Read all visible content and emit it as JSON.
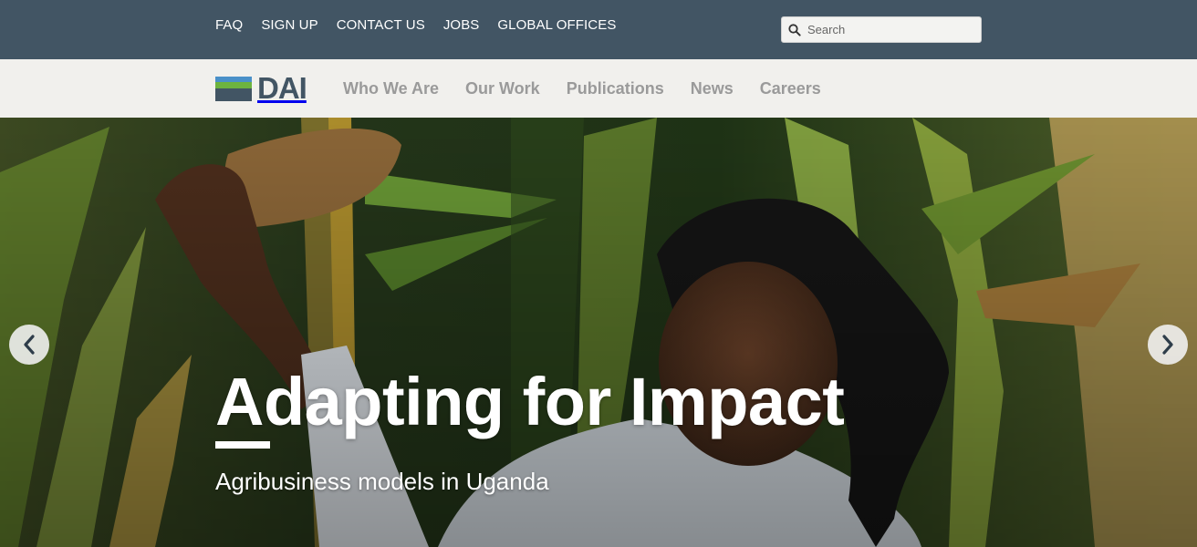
{
  "utility_nav": {
    "links": [
      "FAQ",
      "SIGN UP",
      "CONTACT US",
      "JOBS",
      "GLOBAL OFFICES"
    ]
  },
  "search": {
    "placeholder": "Search",
    "icon": "search-icon"
  },
  "logo": {
    "text": "DAI",
    "stripe_colors": [
      "#4a90c8",
      "#6db33f",
      "#425564",
      "#425564"
    ]
  },
  "main_nav": {
    "items": [
      "Who We Are",
      "Our Work",
      "Publications",
      "News",
      "Careers"
    ]
  },
  "hero": {
    "title": "Adapting for Impact",
    "subtitle": "Agribusiness models in Uganda",
    "prev_icon": "chevron-left-icon",
    "next_icon": "chevron-right-icon"
  },
  "colors": {
    "utility_bar": "#425564",
    "nav_bar": "#f1f0ed",
    "nav_link": "#9a9a9a",
    "logo_text": "#425564"
  }
}
